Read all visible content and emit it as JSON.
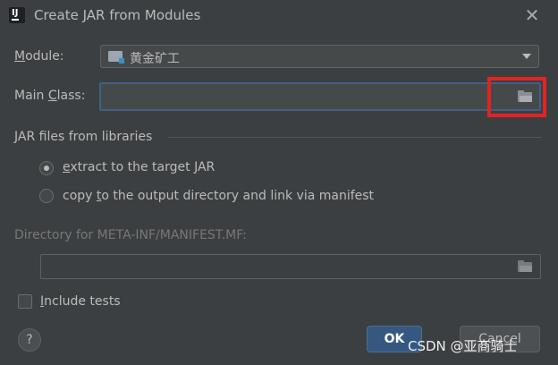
{
  "dialog": {
    "title": "Create JAR from Modules",
    "app_icon": "intellij-icon",
    "close_icon": "close-icon"
  },
  "module": {
    "label_mnemonic": "M",
    "label_rest": "odule:",
    "value": "黄金矿工",
    "icon": "module-folder-icon"
  },
  "main_class": {
    "label_before": "Main ",
    "label_mnemonic": "C",
    "label_after": "lass:",
    "value": "",
    "browse_icon": "folder-icon"
  },
  "jar_files_group": {
    "title": "JAR files from libraries",
    "options": [
      {
        "mnemonic": "e",
        "rest": "xtract to the target JAR",
        "checked": true
      },
      {
        "before": "copy ",
        "mnemonic": "t",
        "rest": "o the output directory and link via manifest",
        "checked": false
      }
    ]
  },
  "manifest_dir": {
    "label": "Directory for META-INF/MANIFEST.MF:",
    "value": "",
    "browse_icon": "folder-icon",
    "enabled": false
  },
  "include_tests": {
    "mnemonic": "I",
    "rest": "nclude tests",
    "checked": false
  },
  "buttons": {
    "help": "?",
    "ok": "OK",
    "cancel": "Cancel"
  },
  "watermark": "CSDN @亚商骑士",
  "colors": {
    "background": "#3c3f41",
    "text": "#bbbbbb",
    "focus_border": "#3d6185",
    "ok_button": "#365880",
    "highlight_box": "#e32222"
  }
}
